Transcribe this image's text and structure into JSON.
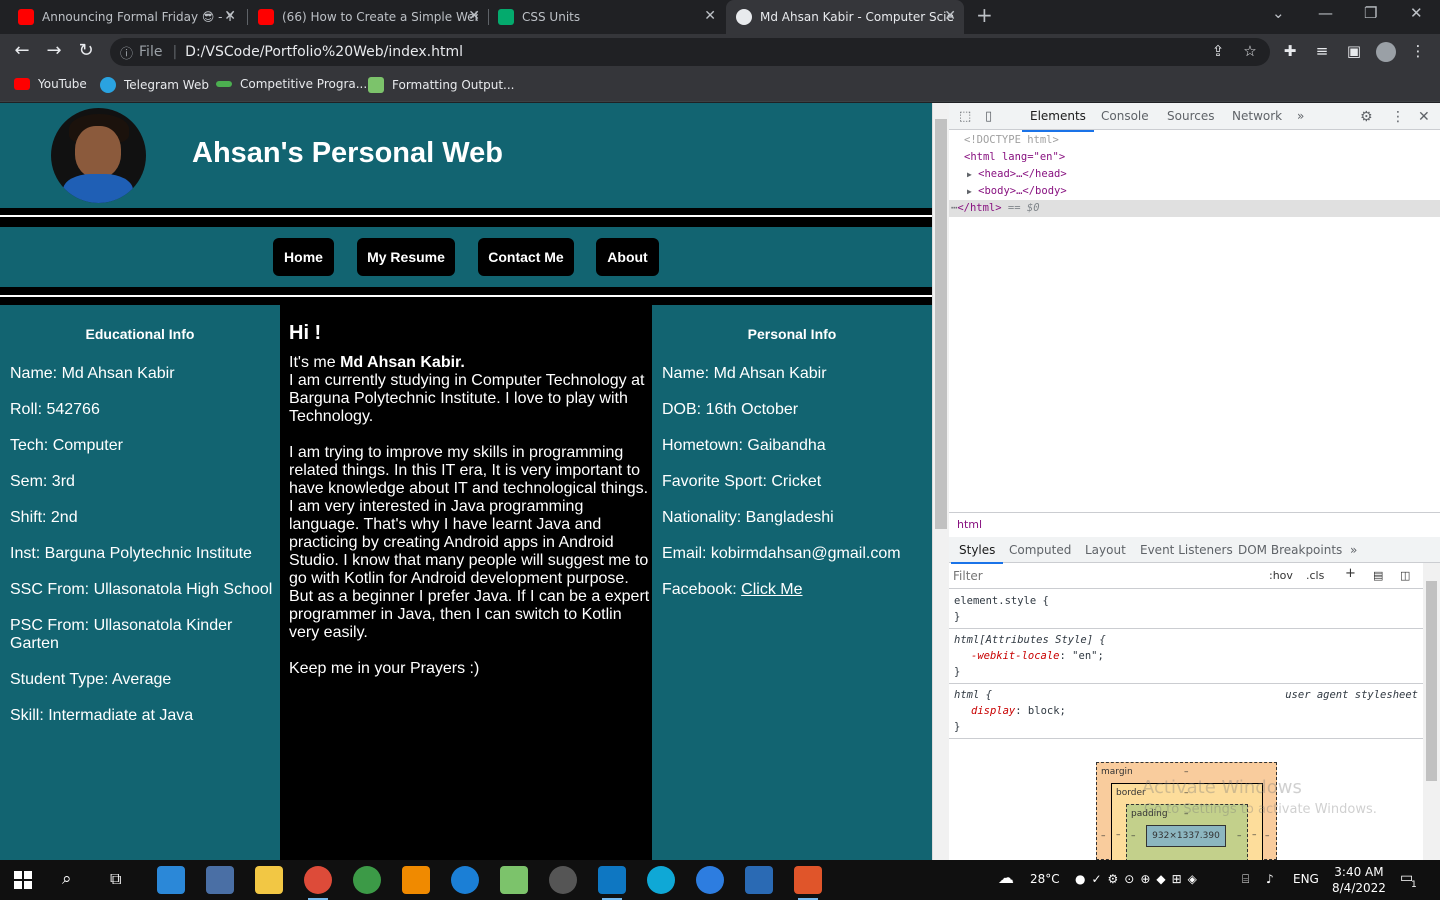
{
  "browser": {
    "tabs": [
      {
        "title": "Announcing Formal Friday 😎 - Y",
        "icon": "youtube-icon",
        "color": "#ff0000"
      },
      {
        "title": "(66) How to Create a Simple Web",
        "icon": "youtube-icon",
        "color": "#ff0000"
      },
      {
        "title": "CSS Units",
        "icon": "w3schools-icon",
        "color": "#04aa6d"
      },
      {
        "title": "Md Ahsan Kabir - Computer Scie",
        "icon": "globe-icon",
        "color": "#e8eaed"
      }
    ],
    "address": {
      "scheme_label": "File",
      "url": "D:/VSCode/Portfolio%20Web/index.html"
    },
    "bookmarks": [
      {
        "label": "YouTube",
        "icon": "youtube-icon",
        "color": "#ff0000"
      },
      {
        "label": "Telegram Web",
        "icon": "telegram-icon",
        "color": "#2aa3e0"
      },
      {
        "label": "Competitive Progra...",
        "icon": "codeforces-icon",
        "color": "#4caf50"
      },
      {
        "label": "Formatting Output...",
        "icon": "sheet-icon",
        "color": "#7cc36b"
      }
    ]
  },
  "site": {
    "title": "Ahsan's Personal Web",
    "nav": [
      "Home",
      "My Resume",
      "Contact Me",
      "About"
    ],
    "left": {
      "heading": "Educational Info",
      "items": [
        "Name: Md Ahsan Kabir",
        "Roll: 542766",
        "Tech: Computer",
        "Sem: 3rd",
        "Shift: 2nd",
        "Inst: Barguna Polytechnic Institute",
        "SSC From: Ullasonatola High School",
        "PSC From: Ullasonatola Kinder Garten",
        "Student Type: Average",
        "Skill: Intermadiate at Java"
      ]
    },
    "middle": {
      "greeting": "Hi !",
      "intro_prefix": "It's me ",
      "intro_name": "Md Ahsan Kabir.",
      "p1": "I am currently studying in Computer Technology at Barguna Polytechnic Institute. I love to play with Technology.",
      "p2": "I am trying to improve my skills in programming related things. In this IT era, It is very important to have knowledge about IT and technological things. I am very interested in Java programming language. That's why I have learnt Java and practicing by creating Android apps in Android Studio. I know that many people will suggest me to go with Kotlin for Android development purpose. But as a beginner I prefer Java. If I can be a expert programmer in Java, then I can switch to Kotlin very easily.",
      "p3": "Keep me in your Prayers :)"
    },
    "right": {
      "heading": "Personal Info",
      "items": [
        "Name: Md Ahsan Kabir",
        "DOB: 16th October",
        "Hometown: Gaibandha",
        "Favorite Sport: Cricket",
        "Nationality: Bangladeshi",
        "Email: kobirmdahsan@gmail.com"
      ],
      "facebook_label": "Facebook: ",
      "facebook_link": "Click Me"
    }
  },
  "devtools": {
    "tabs": [
      "Elements",
      "Console",
      "Sources",
      "Network"
    ],
    "dom": {
      "doctype": "<!DOCTYPE html>",
      "html_open": "<html lang=\"en\">",
      "head": "<head>…</head>",
      "body": "<body>…</body>",
      "html_close": "</html>",
      "selected_marker": "== $0"
    },
    "breadcrumb": "html",
    "style_tabs": [
      "Styles",
      "Computed",
      "Layout",
      "Event Listeners",
      "DOM Breakpoints"
    ],
    "filter_placeholder": "Filter",
    "hov": ":hov",
    "cls": ".cls",
    "rules": {
      "r1_selector": "element.style {",
      "r2_selector": "html[Attributes Style] {",
      "r2_prop": "-webkit-locale",
      "r2_val": "\"en\";",
      "r3_selector": "html {",
      "r3_origin": "user agent stylesheet",
      "r3_prop": "display",
      "r3_val": "block;",
      "close": "}"
    },
    "box": {
      "margin": "margin",
      "border": "border",
      "padding": "padding",
      "content": "932×1337.390",
      "dash": "–"
    }
  },
  "watermark": {
    "line1": "Activate Windows",
    "line2": "Go to Settings to activate Windows."
  },
  "taskbar": {
    "weather": "28°C",
    "lang": "ENG",
    "time": "3:40 AM",
    "date": "8/4/2022",
    "notif_count": "1"
  }
}
